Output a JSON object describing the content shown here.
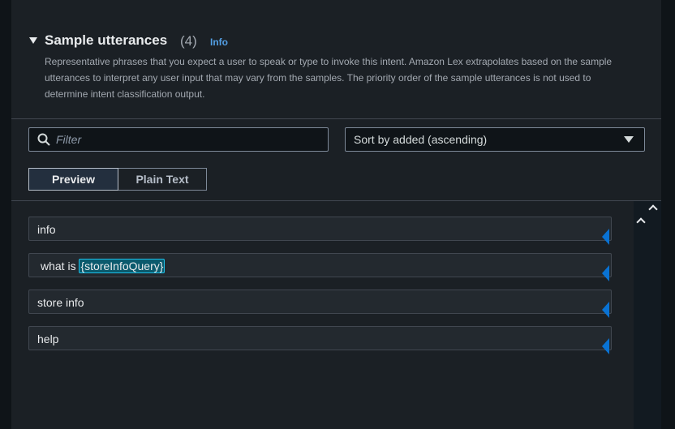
{
  "section": {
    "title": "Sample utterances",
    "count": "(4)",
    "info_link": "Info",
    "description": "Representative phrases that you expect a user to speak or type to invoke this intent. Amazon Lex extrapolates based on the sample utterances to interpret any user input that may vary from the samples. The priority order of the sample utterances is not used to determine intent classification output."
  },
  "filter": {
    "placeholder": "Filter"
  },
  "sort": {
    "selected": "Sort by added (ascending)"
  },
  "view_toggle": {
    "preview": "Preview",
    "plain_text": "Plain Text",
    "active": "Preview"
  },
  "utterances": [
    {
      "prefix": "info",
      "slot": ""
    },
    {
      "prefix": "what is ",
      "slot": "{storeInfoQuery}"
    },
    {
      "prefix": "store info",
      "slot": ""
    },
    {
      "prefix": "help",
      "slot": ""
    }
  ],
  "colors": {
    "slot_highlight": "#0b5a6d",
    "info_link": "#539fe5",
    "marker": "#0972d3"
  }
}
